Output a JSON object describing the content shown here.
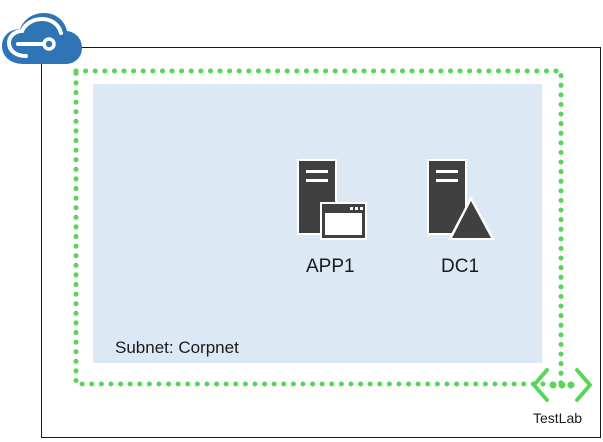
{
  "diagram": {
    "subnet": {
      "label": "Subnet: Corpnet"
    },
    "vnet": {
      "label": "TestLab",
      "icon": "virtual-network-icon"
    },
    "cloud": {
      "icon": "azure-cloud-icon"
    },
    "servers": [
      {
        "name": "APP1",
        "icon": "application-server-icon"
      },
      {
        "name": "DC1",
        "icon": "domain-controller-icon"
      }
    ]
  },
  "colors": {
    "vnet_border": "#59d659",
    "subnet_fill": "#dde8f5",
    "cloud": "#2f74b5",
    "server": "#404040",
    "vnet_icon": "#59d659"
  }
}
